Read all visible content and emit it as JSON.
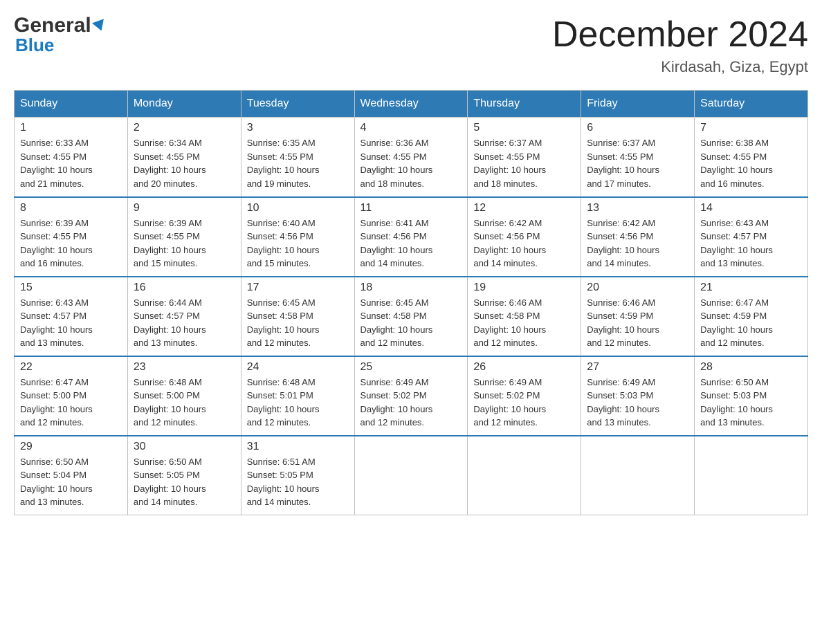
{
  "logo": {
    "name_part1": "General",
    "name_part2": "Blue"
  },
  "title": "December 2024",
  "location": "Kirdasah, Giza, Egypt",
  "days_header": [
    "Sunday",
    "Monday",
    "Tuesday",
    "Wednesday",
    "Thursday",
    "Friday",
    "Saturday"
  ],
  "weeks": [
    [
      {
        "day": "1",
        "sunrise": "6:33 AM",
        "sunset": "4:55 PM",
        "daylight": "10 hours and 21 minutes."
      },
      {
        "day": "2",
        "sunrise": "6:34 AM",
        "sunset": "4:55 PM",
        "daylight": "10 hours and 20 minutes."
      },
      {
        "day": "3",
        "sunrise": "6:35 AM",
        "sunset": "4:55 PM",
        "daylight": "10 hours and 19 minutes."
      },
      {
        "day": "4",
        "sunrise": "6:36 AM",
        "sunset": "4:55 PM",
        "daylight": "10 hours and 18 minutes."
      },
      {
        "day": "5",
        "sunrise": "6:37 AM",
        "sunset": "4:55 PM",
        "daylight": "10 hours and 18 minutes."
      },
      {
        "day": "6",
        "sunrise": "6:37 AM",
        "sunset": "4:55 PM",
        "daylight": "10 hours and 17 minutes."
      },
      {
        "day": "7",
        "sunrise": "6:38 AM",
        "sunset": "4:55 PM",
        "daylight": "10 hours and 16 minutes."
      }
    ],
    [
      {
        "day": "8",
        "sunrise": "6:39 AM",
        "sunset": "4:55 PM",
        "daylight": "10 hours and 16 minutes."
      },
      {
        "day": "9",
        "sunrise": "6:39 AM",
        "sunset": "4:55 PM",
        "daylight": "10 hours and 15 minutes."
      },
      {
        "day": "10",
        "sunrise": "6:40 AM",
        "sunset": "4:56 PM",
        "daylight": "10 hours and 15 minutes."
      },
      {
        "day": "11",
        "sunrise": "6:41 AM",
        "sunset": "4:56 PM",
        "daylight": "10 hours and 14 minutes."
      },
      {
        "day": "12",
        "sunrise": "6:42 AM",
        "sunset": "4:56 PM",
        "daylight": "10 hours and 14 minutes."
      },
      {
        "day": "13",
        "sunrise": "6:42 AM",
        "sunset": "4:56 PM",
        "daylight": "10 hours and 14 minutes."
      },
      {
        "day": "14",
        "sunrise": "6:43 AM",
        "sunset": "4:57 PM",
        "daylight": "10 hours and 13 minutes."
      }
    ],
    [
      {
        "day": "15",
        "sunrise": "6:43 AM",
        "sunset": "4:57 PM",
        "daylight": "10 hours and 13 minutes."
      },
      {
        "day": "16",
        "sunrise": "6:44 AM",
        "sunset": "4:57 PM",
        "daylight": "10 hours and 13 minutes."
      },
      {
        "day": "17",
        "sunrise": "6:45 AM",
        "sunset": "4:58 PM",
        "daylight": "10 hours and 12 minutes."
      },
      {
        "day": "18",
        "sunrise": "6:45 AM",
        "sunset": "4:58 PM",
        "daylight": "10 hours and 12 minutes."
      },
      {
        "day": "19",
        "sunrise": "6:46 AM",
        "sunset": "4:58 PM",
        "daylight": "10 hours and 12 minutes."
      },
      {
        "day": "20",
        "sunrise": "6:46 AM",
        "sunset": "4:59 PM",
        "daylight": "10 hours and 12 minutes."
      },
      {
        "day": "21",
        "sunrise": "6:47 AM",
        "sunset": "4:59 PM",
        "daylight": "10 hours and 12 minutes."
      }
    ],
    [
      {
        "day": "22",
        "sunrise": "6:47 AM",
        "sunset": "5:00 PM",
        "daylight": "10 hours and 12 minutes."
      },
      {
        "day": "23",
        "sunrise": "6:48 AM",
        "sunset": "5:00 PM",
        "daylight": "10 hours and 12 minutes."
      },
      {
        "day": "24",
        "sunrise": "6:48 AM",
        "sunset": "5:01 PM",
        "daylight": "10 hours and 12 minutes."
      },
      {
        "day": "25",
        "sunrise": "6:49 AM",
        "sunset": "5:02 PM",
        "daylight": "10 hours and 12 minutes."
      },
      {
        "day": "26",
        "sunrise": "6:49 AM",
        "sunset": "5:02 PM",
        "daylight": "10 hours and 12 minutes."
      },
      {
        "day": "27",
        "sunrise": "6:49 AM",
        "sunset": "5:03 PM",
        "daylight": "10 hours and 13 minutes."
      },
      {
        "day": "28",
        "sunrise": "6:50 AM",
        "sunset": "5:03 PM",
        "daylight": "10 hours and 13 minutes."
      }
    ],
    [
      {
        "day": "29",
        "sunrise": "6:50 AM",
        "sunset": "5:04 PM",
        "daylight": "10 hours and 13 minutes."
      },
      {
        "day": "30",
        "sunrise": "6:50 AM",
        "sunset": "5:05 PM",
        "daylight": "10 hours and 14 minutes."
      },
      {
        "day": "31",
        "sunrise": "6:51 AM",
        "sunset": "5:05 PM",
        "daylight": "10 hours and 14 minutes."
      },
      null,
      null,
      null,
      null
    ]
  ],
  "labels": {
    "sunrise": "Sunrise:",
    "sunset": "Sunset:",
    "daylight": "Daylight:"
  }
}
